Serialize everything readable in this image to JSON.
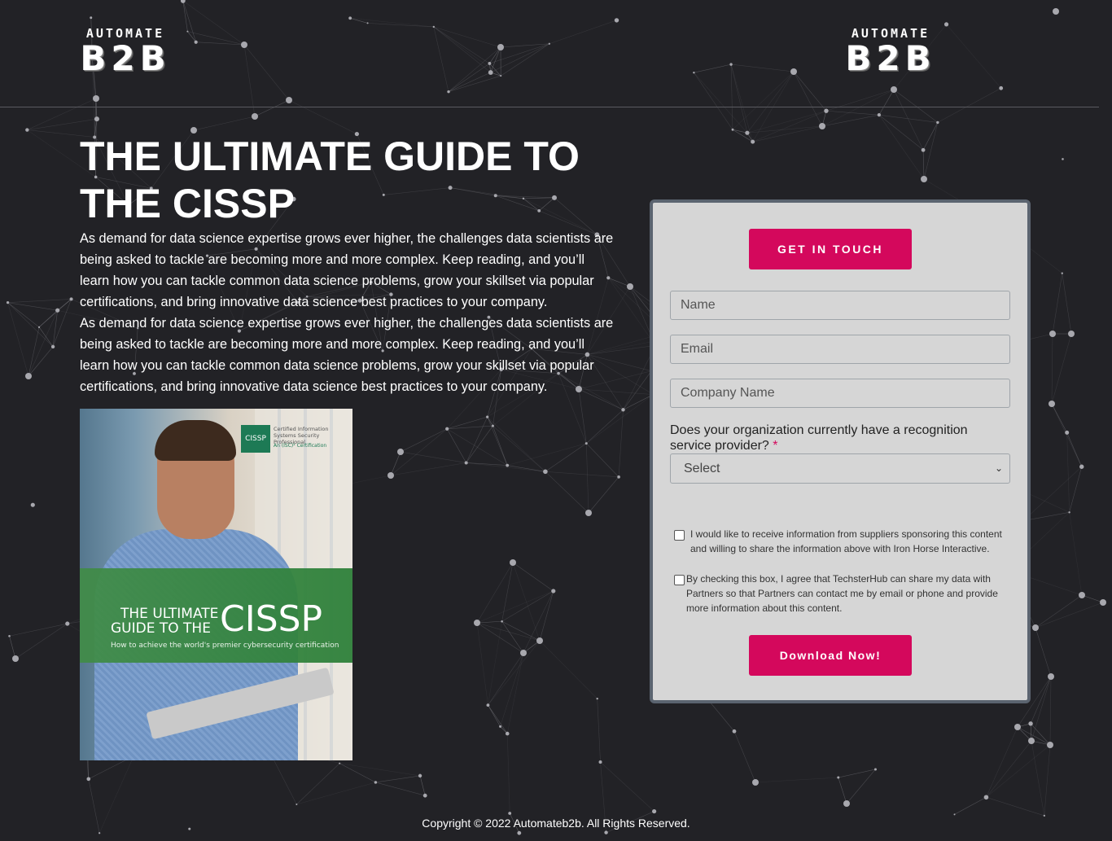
{
  "header": {
    "logo_left": {
      "top": "AUTOMATE",
      "big": "B2B"
    },
    "logo_right": {
      "top": "AUTOMATE",
      "big": "B2B"
    }
  },
  "main": {
    "title_line1": "THE ULTIMATE GUIDE TO",
    "title_line2": "THE CISSP",
    "paragraphs": [
      "As demand for data science expertise grows ever higher, the challenges data scientists are being asked to tackle are becoming more and more complex. Keep reading, and you’ll learn how you can tackle common data science problems, grow your skillset via popular certifications, and bring innovative data science best practices to your company.",
      "As demand for data science expertise grows ever higher, the challenges data scientists are being asked to tackle are becoming more and more complex. Keep reading, and you’ll learn how you can tackle common data science problems, grow your skillset via popular certifications, and bring innovative data science best practices to your company."
    ],
    "cover": {
      "badge": "CISSP",
      "cert_text": "Certified Information Systems Security Professional",
      "cert_org": "An (ISC)² Certification",
      "title_line1": "THE ULTIMATE",
      "title_line2": "GUIDE TO THE",
      "title_big": "CISSP",
      "subtitle": "How to achieve the world's premier cybersecurity certification"
    }
  },
  "form": {
    "get_in_touch": "GET IN TOUCH",
    "name_placeholder": "Name",
    "email_placeholder": "Email",
    "company_placeholder": "Company Name",
    "question": "Does your organization currently have a recognition service provider?",
    "required_mark": "*",
    "select_value": "Select",
    "checkbox1": "I would like to receive information from suppliers sponsoring this content and willing to share the information above with Iron Horse Interactive.",
    "checkbox2": "By checking this box, I agree that TechsterHub can share my data with Partners so that Partners can contact me by email or phone and provide more information about this content.",
    "download": "Download Now!"
  },
  "footer": {
    "copyright": "Copyright © 2022 Automateb2b. All Rights Reserved."
  },
  "colors": {
    "background": "#222226",
    "accent": "#d4085c",
    "form_bg": "#d6d6d6",
    "form_border": "#5b6470"
  }
}
